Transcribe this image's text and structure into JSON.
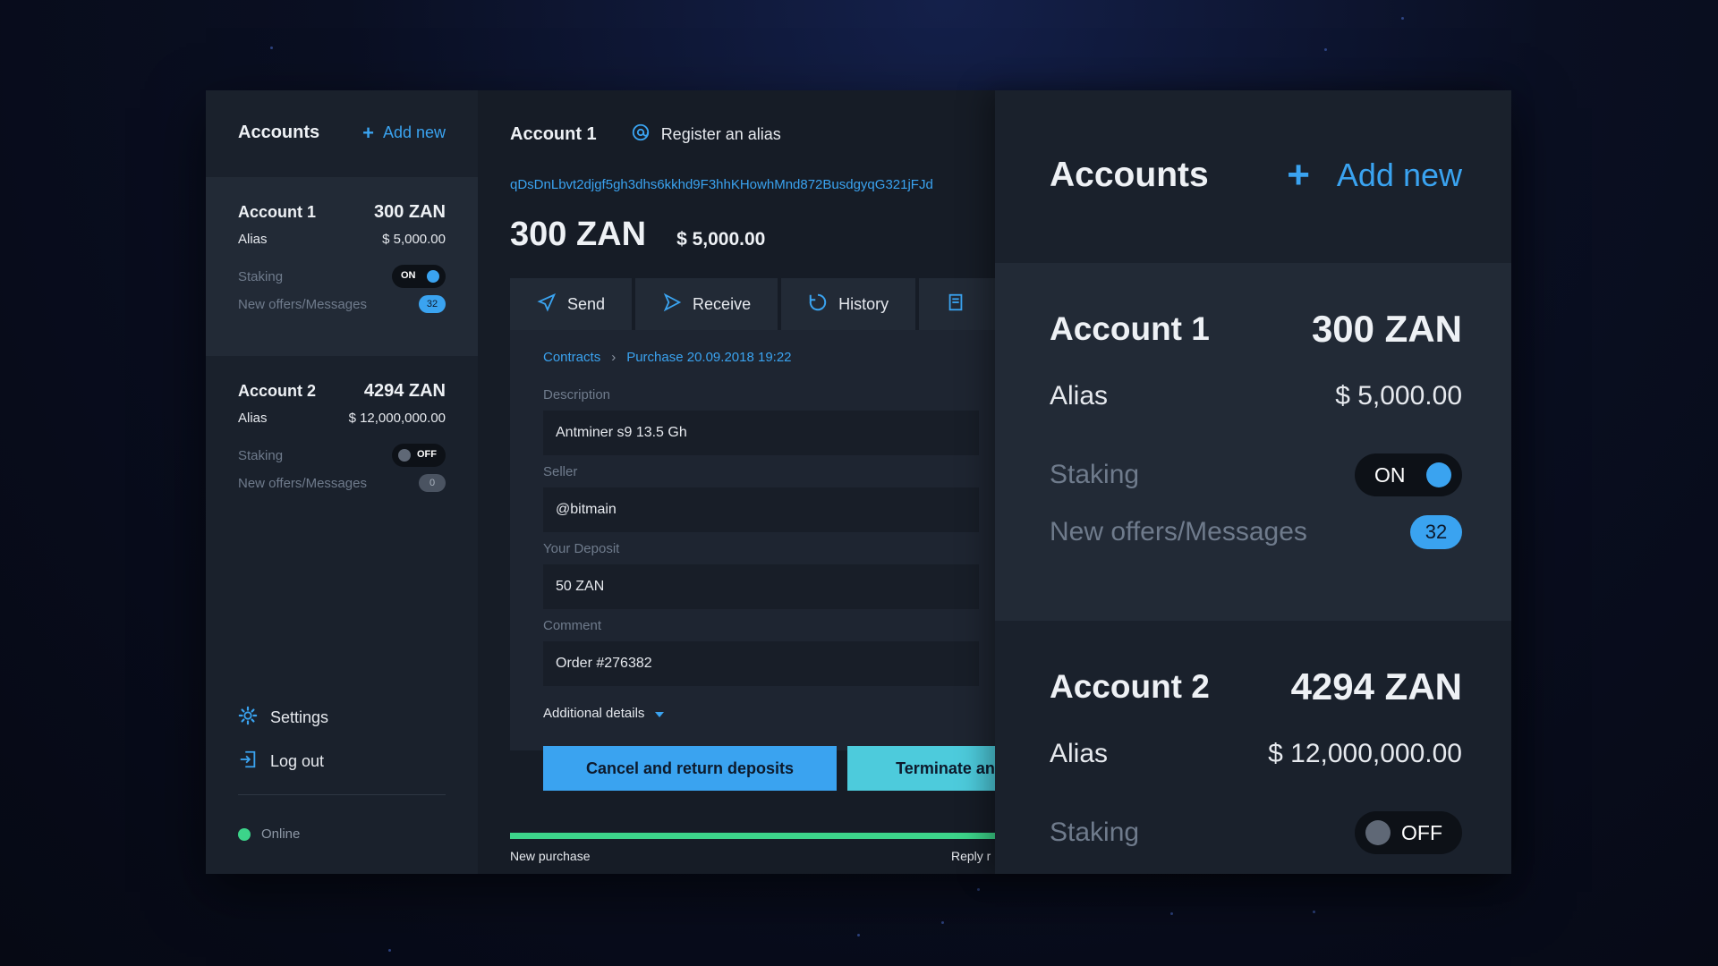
{
  "colors": {
    "accent": "#3aa3f0",
    "teal": "#4dcbdc",
    "online": "#3cd48a",
    "background": "#0a0f22"
  },
  "sidebar": {
    "title": "Accounts",
    "add_new": "Add new",
    "accounts": [
      {
        "name": "Account 1",
        "balance": "300 ZAN",
        "alias_label": "Alias",
        "usd": "$ 5,000.00",
        "staking_label": "Staking",
        "staking_state": "ON",
        "messages_label": "New offers/Messages",
        "messages_count": "32"
      },
      {
        "name": "Account 2",
        "balance": "4294 ZAN",
        "alias_label": "Alias",
        "usd": "$ 12,000,000.00",
        "staking_label": "Staking",
        "staking_state": "OFF",
        "messages_label": "New offers/Messages",
        "messages_count": "0"
      }
    ],
    "menu": [
      {
        "label": "Settings",
        "icon": "gear-icon"
      },
      {
        "label": "Log out",
        "icon": "logout-icon"
      }
    ],
    "status": "Online"
  },
  "main": {
    "title": "Account 1",
    "register_alias": "Register an alias",
    "address": "qDsDnLbvt2djgf5gh3dhs6kkhd9F3hhKHowhMnd872BusdgyqG321jFJd",
    "balance_zan": "300 ZAN",
    "balance_usd": "$ 5,000.00",
    "tabs": [
      {
        "label": "Send",
        "icon": "send-icon"
      },
      {
        "label": "Receive",
        "icon": "receive-icon"
      },
      {
        "label": "History",
        "icon": "history-icon"
      },
      {
        "label": "",
        "icon": "contracts-icon"
      }
    ],
    "breadcrumb": {
      "root": "Contracts",
      "current": "Purchase 20.09.2018 19:22"
    },
    "fields": [
      {
        "label": "Description",
        "value": "Antminer s9 13.5 Gh"
      },
      {
        "label": "Seller",
        "value": "@bitmain"
      },
      {
        "label": "Your Deposit",
        "value": "50 ZAN"
      },
      {
        "label": "Comment",
        "value": "Order #276382"
      }
    ],
    "additional_details": "Additional details",
    "buttons": {
      "cancel": "Cancel and return deposits",
      "terminate": "Terminate and"
    },
    "progress": {
      "left_label": "New purchase",
      "right_label": "Reply r"
    }
  },
  "zoom": {
    "title": "Accounts",
    "add_new": "Add new",
    "accounts": [
      {
        "name": "Account 1",
        "balance": "300 ZAN",
        "alias_label": "Alias",
        "usd": "$ 5,000.00",
        "staking_label": "Staking",
        "staking_state": "ON",
        "messages_label": "New offers/Messages",
        "messages_count": "32"
      },
      {
        "name": "Account 2",
        "balance": "4294 ZAN",
        "alias_label": "Alias",
        "usd": "$ 12,000,000.00",
        "staking_label": "Staking",
        "staking_state": "OFF"
      }
    ]
  }
}
